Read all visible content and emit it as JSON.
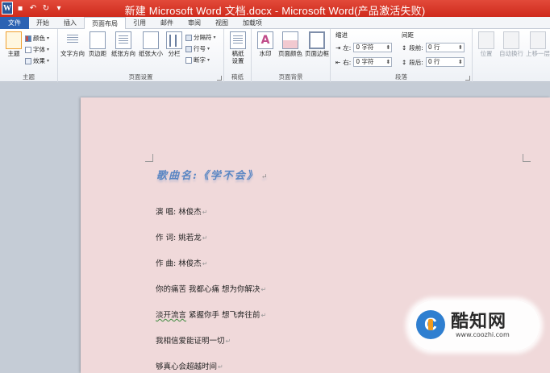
{
  "window": {
    "title": "新建 Microsoft Word 文档.docx - Microsoft Word(产品激活失败)",
    "app_letter": "W"
  },
  "tabs": [
    "文件",
    "开始",
    "插入",
    "页面布局",
    "引用",
    "邮件",
    "审阅",
    "视图",
    "加载项"
  ],
  "active_tab": "页面布局",
  "ribbon": {
    "themes": {
      "label": "主题",
      "big": "主题",
      "colors": "颜色",
      "fonts": "字体",
      "effects": "效果"
    },
    "page_setup": {
      "label": "页面设置",
      "text_direction": "文字方向",
      "margins": "页边距",
      "orientation": "纸张方向",
      "size": "纸张大小",
      "columns": "分栏",
      "breaks": "分隔符",
      "line_numbers": "行号",
      "hyphenation": "断字"
    },
    "draft": {
      "label": "稿纸",
      "btn": "稿纸\n设置"
    },
    "background": {
      "label": "页面背景",
      "watermark": "水印",
      "color": "页面颜色",
      "borders": "页面边框"
    },
    "paragraph": {
      "label": "段落",
      "indent": "缩进",
      "spacing": "间距",
      "left": "左:",
      "right": "右:",
      "before": "段前:",
      "after": "段后:",
      "left_value": "0 字符",
      "right_value": "0 字符",
      "before_value": "0 行",
      "after_value": "0 行"
    },
    "arrange": {
      "position": "位置",
      "wrap": "自动换行",
      "forward": "上移一层"
    }
  },
  "document": {
    "title": "歌曲名:《学不会》",
    "lines": [
      "演  唱:  林俊杰",
      "作  词:  姚若龙",
      "作  曲:  林俊杰",
      "你的痛苦 我都心痛 想为你解决",
      "淡开流言",
      " 紧握你手 想飞奔往前",
      "我相信爱能证明一切",
      "够真心会超越时间"
    ]
  },
  "watermark": {
    "name": "酷知网",
    "url": "www.coozhi.com"
  }
}
